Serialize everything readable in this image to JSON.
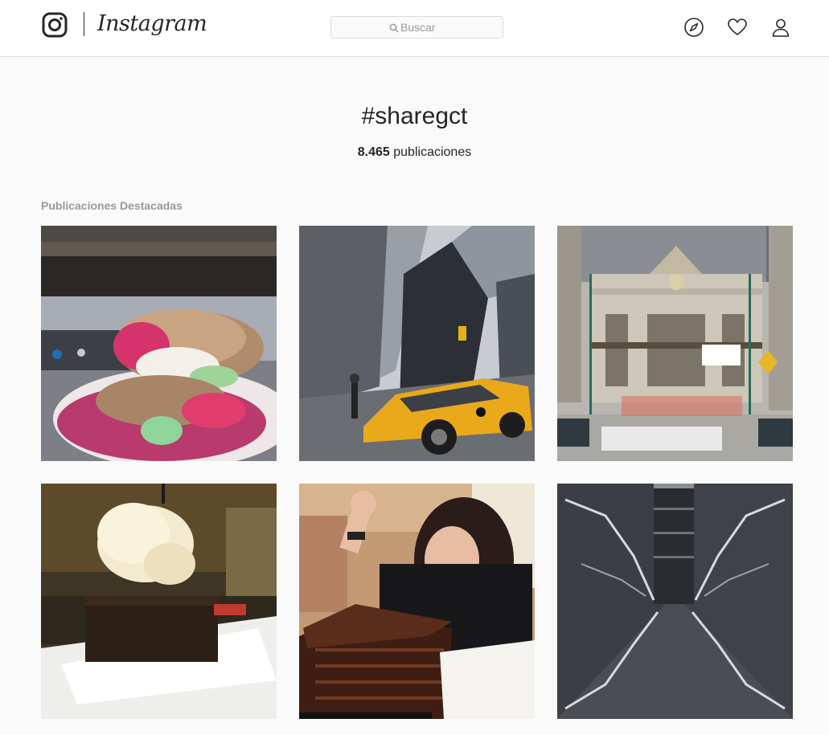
{
  "header": {
    "logo_text": "Instagram",
    "search": {
      "placeholder": "Buscar",
      "value": ""
    },
    "icons": [
      "compass-icon",
      "heart-icon",
      "user-icon"
    ]
  },
  "tag": {
    "title": "#sharegct",
    "post_count": "8.465",
    "post_count_label": " publicaciones"
  },
  "featured": {
    "title": "Publicaciones Destacadas",
    "posts": [
      {
        "subject": "pink-cake-sandwich"
      },
      {
        "subject": "yellow-taxi-skyscrapers"
      },
      {
        "subject": "grand-central-facade"
      },
      {
        "subject": "brownie-ice-cream"
      },
      {
        "subject": "woman-chocolate-cake"
      },
      {
        "subject": "building-atrium"
      }
    ]
  },
  "colors": {
    "background": "#fafafa",
    "header_bg": "#ffffff",
    "border": "#dbdbdb",
    "text": "#262626",
    "muted": "#999999"
  }
}
